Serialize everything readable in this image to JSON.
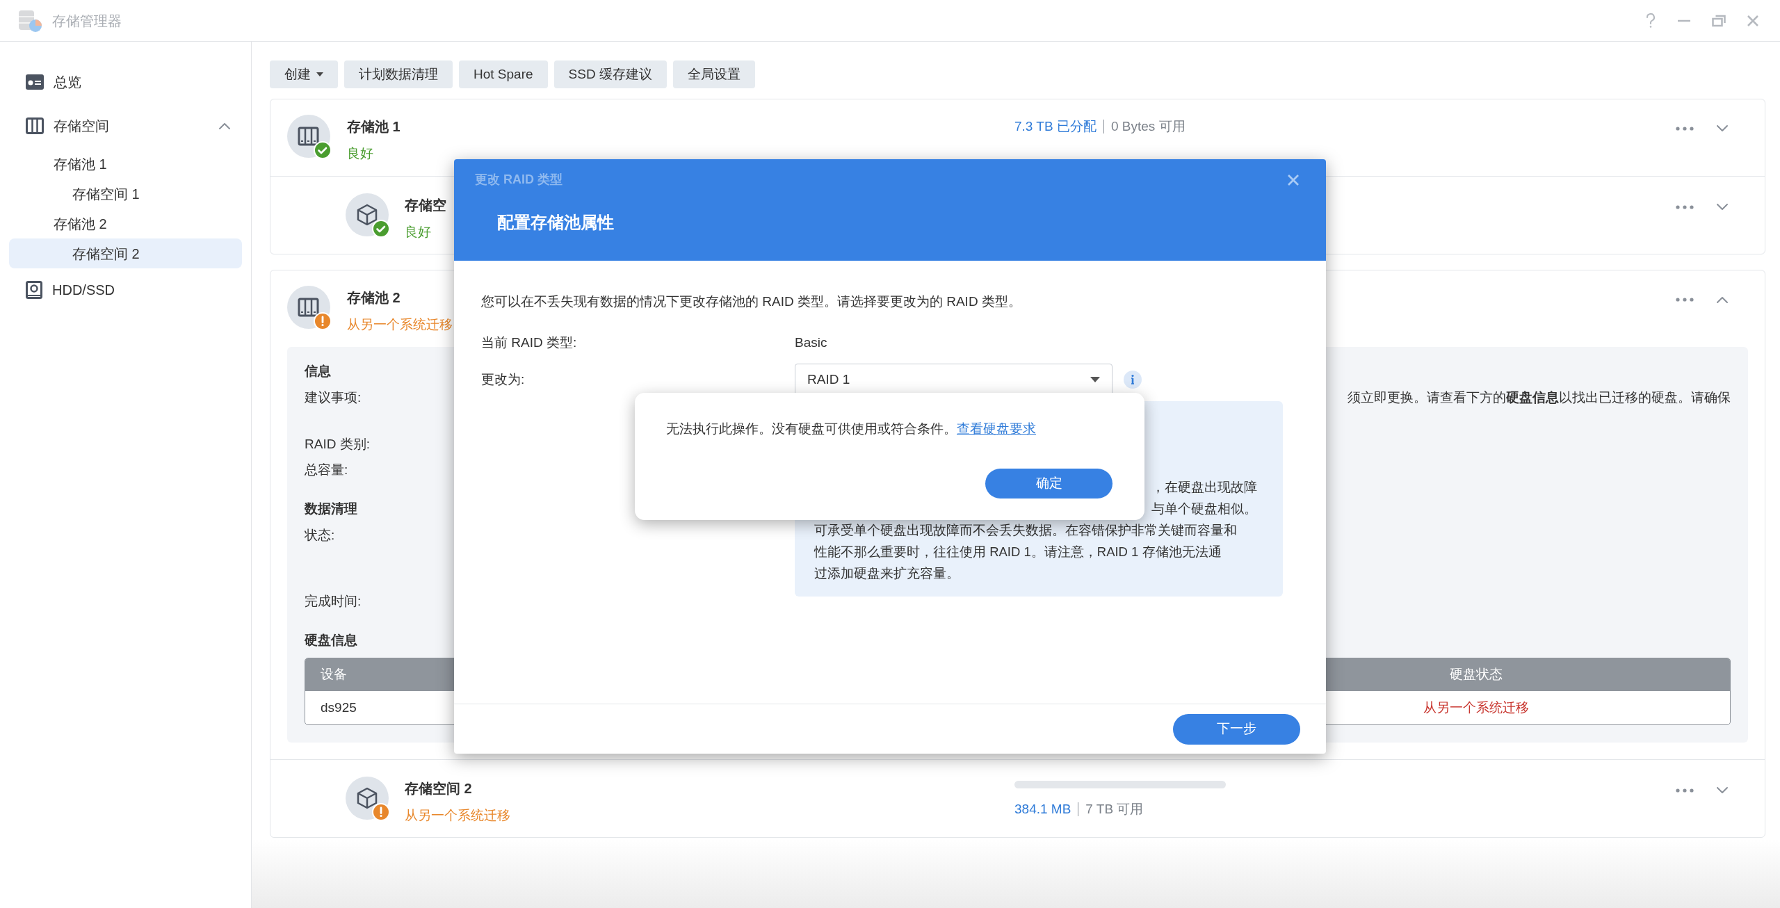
{
  "window": {
    "title": "存储管理器"
  },
  "sidebar": {
    "items": [
      {
        "label": "总览",
        "selected": false
      },
      {
        "label": "存储空间",
        "selected": false,
        "expanded": true,
        "children": [
          {
            "label": "存储池 1",
            "selected": false,
            "children": [
              {
                "label": "存储空间 1",
                "selected": false
              }
            ]
          },
          {
            "label": "存储池 2",
            "selected": false,
            "children": [
              {
                "label": "存储空间 2",
                "selected": true
              }
            ]
          }
        ]
      },
      {
        "label": "HDD/SSD",
        "selected": false
      }
    ]
  },
  "toolbar": [
    {
      "label": "创建",
      "dropdown": true
    },
    {
      "label": "计划数据清理",
      "dropdown": false
    },
    {
      "label": "Hot Spare",
      "dropdown": false
    },
    {
      "label": "SSD 缓存建议",
      "dropdown": false
    },
    {
      "label": "全局设置",
      "dropdown": false
    }
  ],
  "pools": [
    {
      "name": "存储池 1",
      "status": "良好",
      "kind": "ok",
      "used": "7.3 TB 已分配",
      "free": "0 Bytes 可用",
      "expanded": false,
      "spaces": [
        {
          "name": "存储空",
          "status": "良好",
          "kind": "ok",
          "expanded": false
        }
      ]
    },
    {
      "name": "存储池 2",
      "status": "从另一个系统迁移",
      "kind": "warning",
      "expanded": true,
      "details": {
        "sections": [
          {
            "title": "信息",
            "rows": [
              {
                "label": "建议事项:",
                "value": "须立即更换。请查看下方的**硬盘信息**以找出已迁移的硬盘。请确保"
              },
              {
                "label": "RAID 类别:"
              },
              {
                "label": "总容量:"
              }
            ]
          },
          {
            "title": "数据清理",
            "rows": [
              {
                "label": "状态:"
              },
              {
                "label": "完成时间:"
              }
            ]
          }
        ],
        "disks": {
          "title": "硬盘信息",
          "columns": [
            "设备",
            "硬盘状态"
          ],
          "rows": [
            [
              "ds925",
              "从另一个系统迁移"
            ]
          ]
        }
      },
      "spaces": [
        {
          "name": "存储空间 2",
          "status": "从另一个系统迁移",
          "kind": "warning",
          "level": 0,
          "used": "384.1 MB",
          "free": "7 TB 可用",
          "expanded": false
        }
      ]
    }
  ],
  "dialog": {
    "title": "更改 RAID 类型",
    "heading": "配置存储池属性",
    "description": "您可以在不丢失现有数据的情况下更改存储池的 RAID 类型。请选择要更改为的 RAID 类型。",
    "fields": [
      {
        "label": "当前 RAID 类型:",
        "kind": "text",
        "value": "Basic"
      },
      {
        "label": "更改为:",
        "kind": "select",
        "value": "RAID 1"
      }
    ],
    "info_lines": [
      {
        "text": "，在硬盘出现故障",
        "cut": true
      },
      {
        "text": "与单个硬盘相似。",
        "cut": true
      },
      {
        "text": "可承受单个硬盘出现故障而不会丢失数据。在容错保护非常关键而容量和"
      },
      {
        "text": "性能不那么重要时，往往使用 RAID 1。请注意，RAID 1 存储池无法通"
      },
      {
        "text": "过添加硬盘来扩充容量。"
      }
    ],
    "next_button": "下一步"
  },
  "alert": {
    "message": "无法执行此操作。没有硬盘可供使用或符合条件。",
    "link": "查看硬盘要求",
    "button": "确定"
  }
}
